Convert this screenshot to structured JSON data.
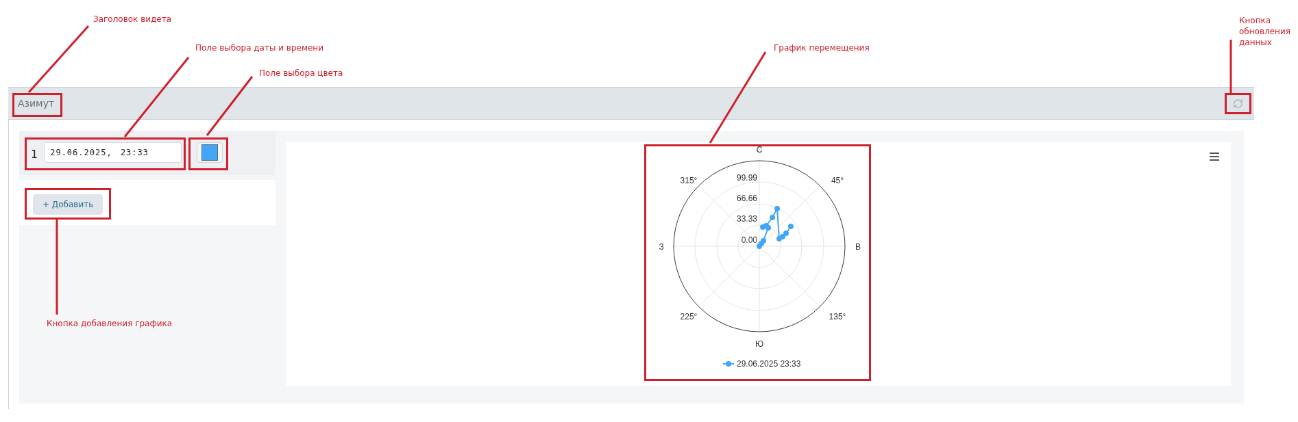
{
  "annotations": [
    {
      "label": "Заголовок видета"
    },
    {
      "label": "Поле выбора даты и времени"
    },
    {
      "label": "Поле выбора цвета"
    },
    {
      "label": "График перемещения"
    },
    {
      "label": "Кнопка обновления данных"
    },
    {
      "label": "Кнопка добавления графика"
    }
  ],
  "widget": {
    "title": "Азимут"
  },
  "series_rows": [
    {
      "index": "1",
      "datetime": "29.06.2025, 23:33",
      "color": "#42a5f5"
    }
  ],
  "add_button": {
    "label": "+ Добавить"
  },
  "chart": {
    "directions": [
      "С",
      "З",
      "В",
      "Ю"
    ],
    "degree_labels": [
      "315°",
      "45°",
      "225°",
      "135°"
    ],
    "radial_ticks": [
      "99.99",
      "66.66",
      "33.33",
      "0.00"
    ],
    "legend": [
      {
        "label": "29.06.2025 23:33",
        "color": "#42a5f5"
      }
    ]
  }
}
